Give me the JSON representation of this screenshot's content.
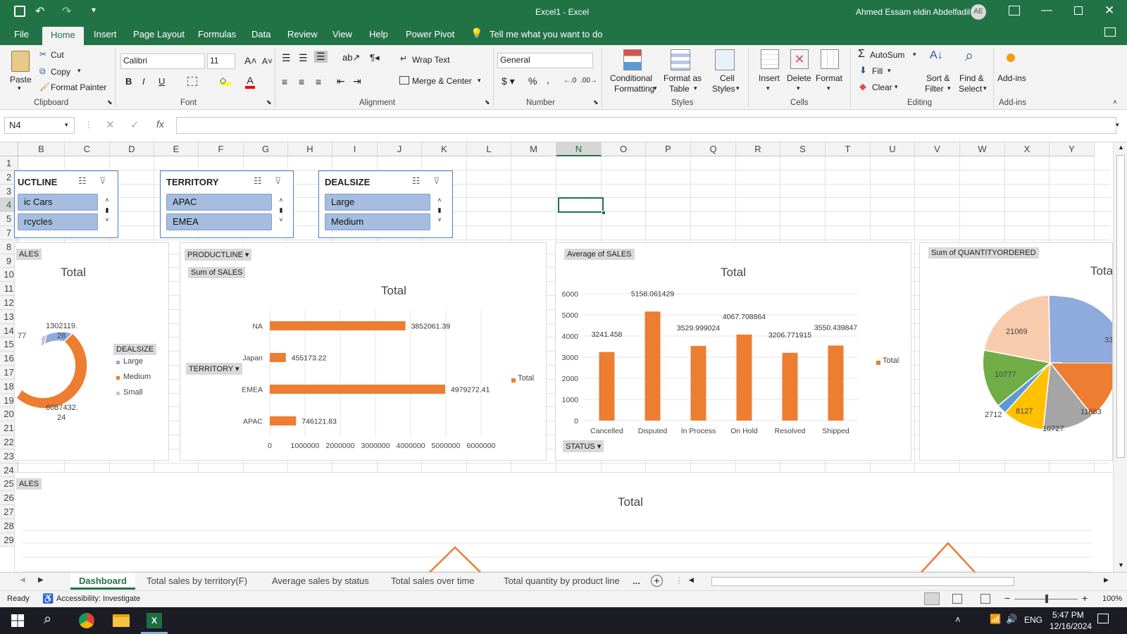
{
  "window": {
    "title": "Excel1  -  Excel",
    "user": "Ahmed Essam eldin Abdelfadil",
    "user_initials": "AE"
  },
  "ribbon_tabs": [
    "File",
    "Home",
    "Insert",
    "Page Layout",
    "Formulas",
    "Data",
    "Review",
    "View",
    "Help",
    "Power Pivot"
  ],
  "tell_me": "Tell me what you want to do",
  "clipboard": {
    "paste": "Paste",
    "cut": "Cut",
    "copy": "Copy",
    "format_painter": "Format Painter",
    "label": "Clipboard"
  },
  "font": {
    "name": "Calibri",
    "size": "11",
    "label": "Font"
  },
  "alignment": {
    "wrap": "Wrap Text",
    "merge": "Merge & Center",
    "label": "Alignment"
  },
  "number": {
    "format": "General",
    "label": "Number"
  },
  "styles": {
    "conditional": "Conditional",
    "conditional2": "Formatting",
    "format_table": "Format as",
    "format_table2": "Table",
    "cell_styles": "Cell",
    "cell_styles2": "Styles",
    "label": "Styles"
  },
  "cells": {
    "insert": "Insert",
    "delete": "Delete",
    "format": "Format",
    "label": "Cells"
  },
  "editing": {
    "autosum": "AutoSum",
    "fill": "Fill",
    "clear": "Clear",
    "sort": "Sort &",
    "sort2": "Filter",
    "find": "Find &",
    "find2": "Select",
    "label": "Editing"
  },
  "addins": {
    "btn": "Add-ins",
    "label": "Add-ins"
  },
  "formula_bar": {
    "name_box": "N4",
    "formula": ""
  },
  "columns": [
    "B",
    "C",
    "D",
    "E",
    "F",
    "G",
    "H",
    "I",
    "J",
    "K",
    "L",
    "M",
    "N",
    "O",
    "P",
    "Q",
    "R",
    "S",
    "T",
    "U",
    "V",
    "W",
    "X",
    "Y"
  ],
  "rows": [
    "1",
    "2",
    "3",
    "4",
    "5",
    "7",
    "8",
    "9",
    "10",
    "11",
    "12",
    "13",
    "14",
    "15",
    "16",
    "17",
    "18",
    "19",
    "20",
    "21",
    "22",
    "23",
    "24",
    "25",
    "26",
    "27",
    "28",
    "29"
  ],
  "slicers": [
    {
      "title": "UCTLINE",
      "items": [
        "ic Cars",
        "rcycles"
      ]
    },
    {
      "title": "TERRITORY",
      "items": [
        "APAC",
        "EMEA"
      ]
    },
    {
      "title": "DEALSIZE",
      "items": [
        "Large",
        "Medium"
      ]
    }
  ],
  "donut": {
    "field": "ALES",
    "title": "Total",
    "legend_field": "DEALSIZE",
    "legend": [
      "Large",
      "Medium",
      "Small"
    ],
    "label1": "1302119.",
    "label1b": "26",
    "label2": "6087432.",
    "label2b": "24",
    "label3": "77"
  },
  "bar_chart": {
    "filter": "PRODUCTLINE",
    "value_field": "Sum of SALES",
    "axis_field": "TERRITORY",
    "title": "Total",
    "legend": "Total",
    "xticks": [
      "0",
      "1000000",
      "2000000",
      "3000000",
      "4000000",
      "5000000",
      "6000000"
    ]
  },
  "column_chart": {
    "value_field": "Average of SALES",
    "axis_field": "STATUS",
    "title": "Total",
    "legend": "Total",
    "yticks": [
      "6000",
      "5000",
      "4000",
      "3000",
      "2000",
      "1000",
      "0"
    ]
  },
  "pie_chart": {
    "value_field": "Sum of QUANTITYORDERED",
    "title": "Tota",
    "labels": [
      "21069",
      "10777",
      "2712",
      "8127",
      "10727",
      "11663",
      "33"
    ]
  },
  "line_chart": {
    "field": "ALES",
    "title": "Total"
  },
  "chart_data": [
    {
      "type": "bar",
      "title": "Total",
      "series": [
        {
          "name": "Total",
          "values": [
            746121.83,
            4979272.41,
            455173.22,
            3852061.39
          ]
        }
      ],
      "categories": [
        "APAC",
        "EMEA",
        "Japan",
        "NA"
      ],
      "xlim": [
        0,
        6000000
      ],
      "data_labels": [
        "746121.83",
        "4979272.41",
        "455173.22",
        "3852061.39"
      ]
    },
    {
      "type": "bar",
      "title": "Total",
      "categories": [
        "Cancelled",
        "Disputed",
        "In Process",
        "On Hold",
        "Resolved",
        "Shipped"
      ],
      "series": [
        {
          "name": "Total",
          "values": [
            3241.458,
            5158.061429,
            3529.999024,
            4067.708864,
            3206.771915,
            3550.439847
          ]
        }
      ],
      "ylim": [
        0,
        6000
      ],
      "data_labels": [
        "3241.458",
        "5158.061429",
        "3529.999024",
        "4067.708864",
        "3206.771915",
        "3550.439847"
      ]
    }
  ],
  "sheet_tabs": [
    "Dashboard",
    "Total sales by territory(F)",
    "Average sales by status",
    "Total sales over time",
    "Total quantity by product line"
  ],
  "sheet_tabs_more": "...",
  "status": {
    "ready": "Ready",
    "accessibility": "Accessibility: Investigate",
    "zoom": "100%"
  },
  "taskbar": {
    "time": "5:47 PM",
    "date": "12/16/2024",
    "lang": "ENG"
  },
  "colors": {
    "excel_green": "#217346",
    "orange": "#ed7d31",
    "blue": "#8faadc",
    "gray": "#a5a5a5",
    "gold": "#ffc000",
    "green": "#70ad47",
    "peach": "#f8cbad",
    "lightblue": "#5b9bd5"
  }
}
